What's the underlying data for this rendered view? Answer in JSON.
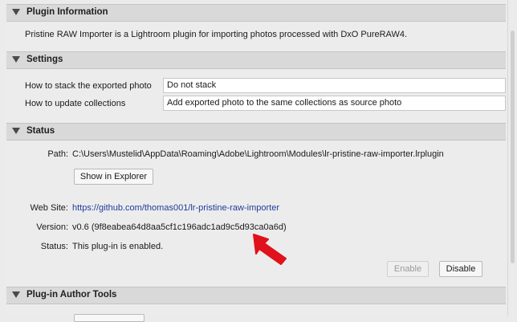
{
  "plugin_info": {
    "title": "Plugin Information",
    "description": "Pristine RAW Importer is a Lightroom plugin for importing photos processed with DxO PureRAW4."
  },
  "settings": {
    "title": "Settings",
    "stack_label": "How to stack the exported photo",
    "stack_value": "Do not stack",
    "collections_label": "How to update collections",
    "collections_value": "Add exported photo to the same collections as source photo"
  },
  "status": {
    "title": "Status",
    "path_label": "Path:",
    "path_value": "C:\\Users\\Mustelid\\AppData\\Roaming\\Adobe\\Lightroom\\Modules\\lr-pristine-raw-importer.lrplugin",
    "show_in_explorer": "Show in Explorer",
    "website_label": "Web Site:",
    "website_value": "https://github.com/thomas001/lr-pristine-raw-importer",
    "version_label": "Version:",
    "version_value": "v0.6 (9f8eabea64d8aa5cf1c196adc1ad9c5d93ca0a6d)",
    "status_label": "Status:",
    "status_value": "This plug-in is enabled.",
    "enable_button": "Enable",
    "disable_button": "Disable"
  },
  "author_tools": {
    "title": "Plug-in Author Tools"
  },
  "annotation": {
    "arrow_color": "#e0121b"
  }
}
